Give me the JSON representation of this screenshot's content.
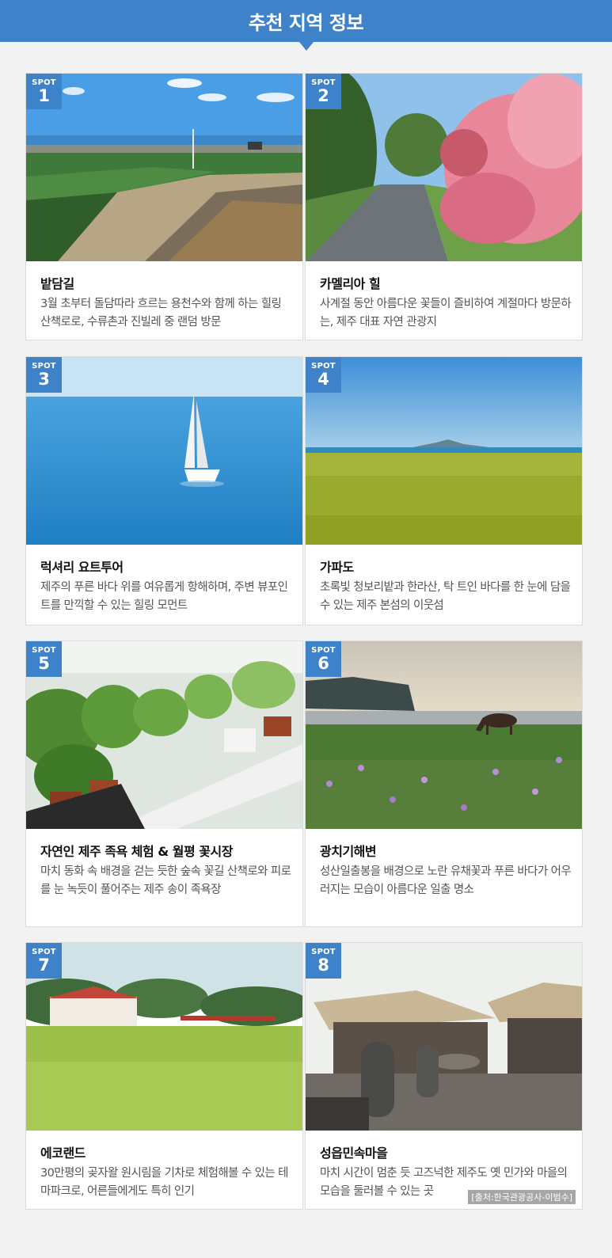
{
  "header": {
    "title": "추천 지역 정보"
  },
  "spot_label": "SPOT",
  "spots": [
    {
      "num": "1",
      "title": "밭담길",
      "desc": "3월 초부터 돌담따라 흐르는 용천수와 함께 하는 힐링 산책로로, 수류촌과 진빌레 중 랜덤 방문"
    },
    {
      "num": "2",
      "title": "카멜리아 힐",
      "desc": "사계절 동안 아름다운 꽃들이 즐비하여 계절마다 방문하는, 제주 대표 자연 관광지"
    },
    {
      "num": "3",
      "title": "럭셔리 요트투어",
      "desc": "제주의 푸른 바다 위를 여유롭게 항해하며, 주변 뷰포인트를 만끽할 수 있는 힐링 모먼트"
    },
    {
      "num": "4",
      "title": "가파도",
      "desc": "초록빛 청보리밭과 한라산, 탁 트인 바다를 한 눈에 담을 수 있는 제주 본섬의 이웃섬"
    },
    {
      "num": "5",
      "title": "자연인 제주 족욕 체험 & 월평 꽃시장",
      "desc": "마치 동화 속 배경을 걷는 듯한 숲속 꽃길 산책로와 피로를 눈 녹듯이 풀어주는 제주 송이 족욕장"
    },
    {
      "num": "6",
      "title": "광치기해변",
      "desc": "성산일출봉을 배경으로 노란 유채꽃과 푸른 바다가 어우러지는 모습이 아름다운 일출 명소"
    },
    {
      "num": "7",
      "title": "에코랜드",
      "desc": "30만평의 곶자왈 원시림을 기차로 체험해볼 수 있는 테마파크로, 어른들에게도 특히 인기"
    },
    {
      "num": "8",
      "title": "성읍민속마을",
      "desc": "마치 시간이 멈춘 듯 고즈넉한 제주도 옛 민가와 마을의 모습을 둘러볼 수 있는 곳",
      "credit": "[출처:한국관광공사-이범수]"
    }
  ],
  "colors": {
    "accent": "#3e83c9",
    "background": "#f2f2f2"
  }
}
